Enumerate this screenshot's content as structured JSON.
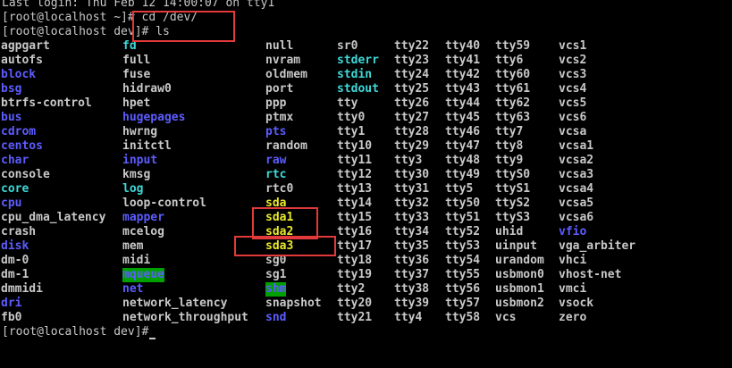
{
  "terminal": {
    "last_login": "Last login: Thu Feb 12 14:00:07 on tty1",
    "cmd_line": "[root@localhost ~]# cd /dev/",
    "ls_line": "[root@localhost dev]# ls",
    "final_prompt": "[root@localhost dev]#"
  },
  "colors": {
    "background": "#000000",
    "text": "#c8c8c8",
    "directory": "#5c5cff",
    "symlink": "#3ed8d8",
    "block_device": "#e8e82c",
    "sticky_dir_bg": "#00a000",
    "highlight": "#e23a3a"
  },
  "listing": {
    "columns": [
      [
        "agpgart",
        "autofs",
        "block",
        "bsg",
        "btrfs-control",
        "bus",
        "cdrom",
        "centos",
        "char",
        "console",
        "core",
        "cpu",
        "cpu_dma_latency",
        "crash",
        "disk",
        "dm-0",
        "dm-1",
        "dmmidi",
        "dri",
        "fb0"
      ],
      [
        "fd",
        "full",
        "fuse",
        "hidraw0",
        "hpet",
        "hugepages",
        "hwrng",
        "initctl",
        "input",
        "kmsg",
        "log",
        "loop-control",
        "mapper",
        "mcelog",
        "mem",
        "midi",
        "mqueue",
        "net",
        "network_latency",
        "network_throughput"
      ],
      [
        "null",
        "nvram",
        "oldmem",
        "port",
        "ppp",
        "ptmx",
        "pts",
        "random",
        "raw",
        "rtc",
        "rtc0",
        "sda",
        "sda1",
        "sda2",
        "sda3",
        "sg0",
        "sg1",
        "shm",
        "snapshot",
        "snd"
      ],
      [
        "sr0",
        "stderr",
        "stdin",
        "stdout",
        "tty",
        "tty0",
        "tty1",
        "tty10",
        "tty11",
        "tty12",
        "tty13",
        "tty14",
        "tty15",
        "tty16",
        "tty17",
        "tty18",
        "tty19",
        "tty2",
        "tty20",
        "tty21"
      ],
      [
        "tty22",
        "tty23",
        "tty24",
        "tty25",
        "tty26",
        "tty27",
        "tty28",
        "tty29",
        "tty3",
        "tty30",
        "tty31",
        "tty32",
        "tty33",
        "tty34",
        "tty35",
        "tty36",
        "tty37",
        "tty38",
        "tty39",
        "tty4"
      ],
      [
        "tty40",
        "tty41",
        "tty42",
        "tty43",
        "tty44",
        "tty45",
        "tty46",
        "tty47",
        "tty48",
        "tty49",
        "tty5",
        "tty50",
        "tty51",
        "tty52",
        "tty53",
        "tty54",
        "tty55",
        "tty56",
        "tty57",
        "tty58"
      ],
      [
        "tty59",
        "tty6",
        "tty60",
        "tty61",
        "tty62",
        "tty63",
        "tty7",
        "tty8",
        "tty9",
        "ttyS0",
        "ttyS1",
        "ttyS2",
        "ttyS3",
        "uhid",
        "uinput",
        "urandom",
        "usbmon0",
        "usbmon1",
        "usbmon2",
        "vcs"
      ],
      [
        "vcs1",
        "vcs2",
        "vcs3",
        "vcs4",
        "vcs5",
        "vcs6",
        "vcsa",
        "vcsa1",
        "vcsa2",
        "vcsa3",
        "vcsa4",
        "vcsa5",
        "vcsa6",
        "vfio",
        "vga_arbiter",
        "vhci",
        "vhost-net",
        "vmci",
        "vsock",
        "zero"
      ]
    ],
    "directories": [
      "block",
      "bsg",
      "bus",
      "cdrom",
      "centos",
      "char",
      "cpu",
      "disk",
      "dri",
      "hugepages",
      "input",
      "mapper",
      "net",
      "pts",
      "raw",
      "snd",
      "vfio"
    ],
    "symlinks": [
      "fd",
      "core",
      "log",
      "rtc",
      "stderr",
      "stdin",
      "stdout"
    ],
    "block_devices": [
      "sda",
      "sda1",
      "sda2",
      "sda3"
    ],
    "sticky_dirs": [
      "mqueue",
      "shm"
    ]
  }
}
